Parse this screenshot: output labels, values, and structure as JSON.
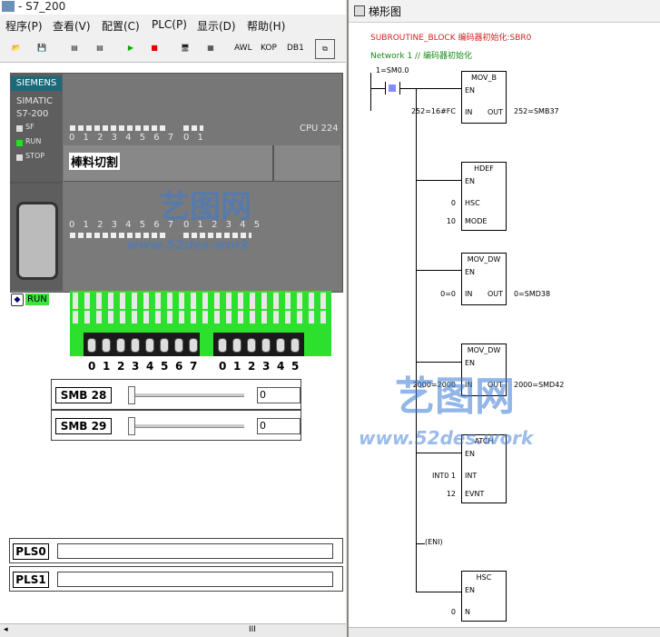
{
  "left_window": {
    "title": "- S7_200",
    "menu": [
      "程序(P)",
      "查看(V)",
      "配置(C)",
      "PLC(P)",
      "显示(D)",
      "帮助(H)"
    ],
    "toolbar_text": [
      "AWL",
      "KOP",
      "DB1"
    ],
    "plc": {
      "brand": "SIEMENS",
      "model_line1": "SIMATIC",
      "model_line2": "S7-200",
      "status_leds": [
        "SF",
        "RUN",
        "STOP"
      ],
      "cpu": "CPU 224",
      "input_bits_top": "0 1 2 3 4 5 6 7",
      "input_bits_top2": "0 1",
      "label": "棒料切割",
      "output_bits": "0 1 2 3 4 5 6 7",
      "output_bits2": "0 1 2 3 4 5",
      "run_indicator": "RUN"
    },
    "switch_numbers_a": [
      "0",
      "1",
      "2",
      "3",
      "4",
      "5",
      "6",
      "7"
    ],
    "switch_numbers_b": [
      "0",
      "1",
      "2",
      "3",
      "4",
      "5"
    ],
    "smb_controls": [
      {
        "label": "SMB 28",
        "value": "0"
      },
      {
        "label": "SMB 29",
        "value": "0"
      }
    ],
    "pls": [
      "PLS0",
      "PLS1"
    ],
    "scroll_grip": "III"
  },
  "right_window": {
    "title": "梯形图",
    "subroutine_header": "SUBROUTINE_BLOCK 编码器初始化:SBR0",
    "network": "Network 1 // 编码器初始化",
    "contact": "1=SM0.0",
    "blocks": [
      {
        "name": "MOV_B",
        "en": "EN",
        "in": "IN",
        "out": "OUT",
        "in_val": "252=16#FC",
        "out_val": "252=SMB37"
      },
      {
        "name": "HDEF",
        "en": "EN",
        "p1": "HSC",
        "p2": "MODE",
        "v1": "0",
        "v2": "10"
      },
      {
        "name": "MOV_DW",
        "en": "EN",
        "in": "IN",
        "out": "OUT",
        "in_val": "0=0",
        "out_val": "0=SMD38"
      },
      {
        "name": "MOV_DW",
        "en": "EN",
        "in": "IN",
        "out": "OUT",
        "in_val": "2000=2000",
        "out_val": "2000=SMD42"
      },
      {
        "name": "ATCH",
        "en": "EN",
        "p1": "INT",
        "p2": "EVNT",
        "v1": "INT0 1",
        "v2": "12"
      },
      {
        "name": "HSC",
        "en": "EN",
        "p1": "N",
        "v1": "0"
      }
    ],
    "eni": "(ENI)"
  },
  "watermark": {
    "text": "艺图网",
    "url": "www.52des.work"
  },
  "colors": {
    "plc_gray": "#777777",
    "green": "#2ee02e",
    "header_red": "#d42020",
    "network_green": "#1a8a1a"
  }
}
